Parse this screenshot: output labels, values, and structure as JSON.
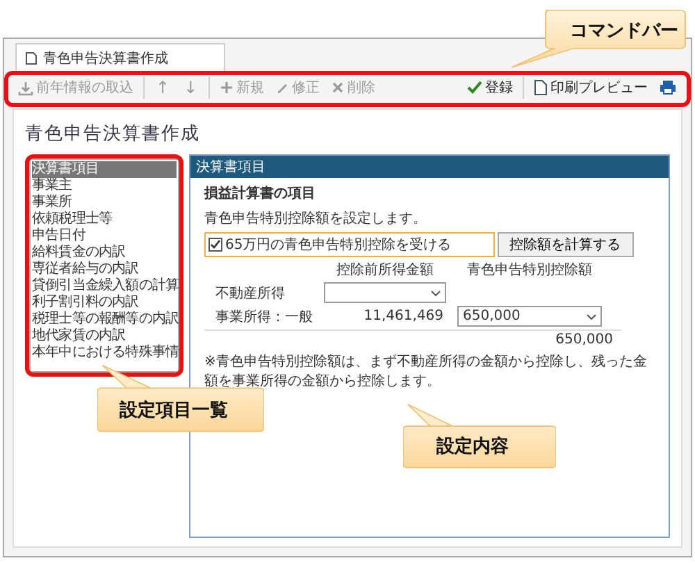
{
  "tab": {
    "label": "青色申告決算書作成",
    "selected": true
  },
  "toolbar": {
    "import": {
      "label": "前年情報の取込",
      "disabled": true
    },
    "move_up": {
      "label": "↑",
      "disabled": true
    },
    "move_down": {
      "label": "↓",
      "disabled": true
    },
    "new": {
      "label": "新規",
      "disabled": true
    },
    "edit": {
      "label": "修正",
      "disabled": true
    },
    "delete": {
      "label": "削除",
      "disabled": true
    },
    "register": {
      "label": "登録",
      "disabled": false
    },
    "preview": {
      "label": "印刷プレビュー",
      "disabled": false
    }
  },
  "page_title": "青色申告決算書作成",
  "items": [
    {
      "label": "決算書項目",
      "selected": true
    },
    {
      "label": "事業主",
      "selected": false
    },
    {
      "label": "事業所",
      "selected": false
    },
    {
      "label": "依頼税理士等",
      "selected": false
    },
    {
      "label": "申告日付",
      "selected": false
    },
    {
      "label": "給料賃金の内訳",
      "selected": false
    },
    {
      "label": "専従者給与の内訳",
      "selected": false
    },
    {
      "label": "貸倒引当金繰入額の計算",
      "selected": false
    },
    {
      "label": "利子割引料の内訳",
      "selected": false
    },
    {
      "label": "税理士等の報酬等の内訳",
      "selected": false
    },
    {
      "label": "地代家賃の内訳",
      "selected": false
    },
    {
      "label": "本年中における特殊事情",
      "selected": false
    }
  ],
  "panel": {
    "header": "決算書項目",
    "heading": "損益計算書の項目",
    "description": "青色申告特別控除額を設定します。",
    "checkbox": {
      "label": "65万円の青色申告特別控除を受ける",
      "checked": true
    },
    "calc_button": "控除額を計算する",
    "columns": [
      "控除前所得金額",
      "青色申告特別控除額"
    ],
    "rows": [
      {
        "kind": "select",
        "label": "不動産所得"
      },
      {
        "kind": "amount",
        "label": "事業所得：一般",
        "pre_amount": "11,461,469",
        "deduction": "650,000"
      }
    ],
    "total": "650,000",
    "note": "※青色申告特別控除額は、まず不動産所得の金額から控除し、残った金額を事業所得の金額から控除します。"
  },
  "callouts": [
    {
      "text": "コマンドバー"
    },
    {
      "text": "設定項目一覧"
    },
    {
      "text": "設定内容"
    }
  ]
}
